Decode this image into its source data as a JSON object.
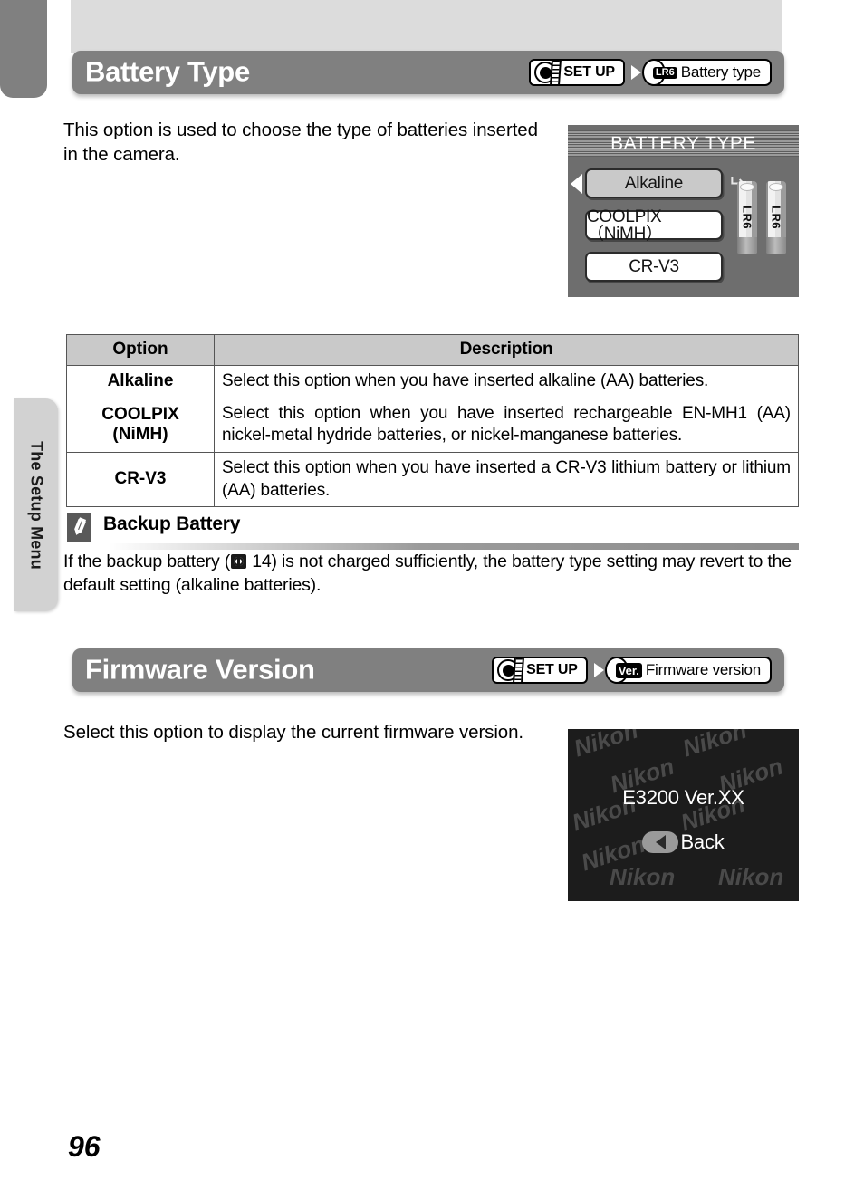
{
  "sidebar": {
    "chapter_label": "The Setup Menu"
  },
  "page": {
    "number": "96"
  },
  "sections": [
    {
      "title": "Battery Type",
      "breadcrumb": {
        "mode_label": "SET UP",
        "mode_icon": "mode-dial-icon",
        "item_badge": "LR6",
        "item_label": "Battery type"
      },
      "body": "This option is used to choose the type of batteries inserted in the camera."
    },
    {
      "title": "Firmware Version",
      "breadcrumb": {
        "mode_label": "SET UP",
        "mode_icon": "mode-dial-icon",
        "item_badge": "Ver.",
        "item_label": "Firmware version"
      },
      "body": "Select this option to display the current firmware version."
    }
  ],
  "battery_lcd": {
    "title": "BATTERY TYPE",
    "options": [
      {
        "label": "Alkaline",
        "selected": true
      },
      {
        "label": "COOLPIX（NiMH）",
        "selected": false
      },
      {
        "label": "CR-V3",
        "selected": false
      }
    ],
    "enter_icon": "enter-return-icon",
    "cursor_icon": "left-cursor-icon",
    "battery_label": "LR6"
  },
  "firmware_lcd": {
    "version_text": "E3200 Ver.XX",
    "back_label": "Back",
    "back_icon": "left-arrow-icon",
    "watermark_text": "Nikon"
  },
  "table": {
    "headers": [
      "Option",
      "Description"
    ],
    "rows": [
      {
        "option": "Alkaline",
        "description": "Select this option when you have inserted alkaline (AA) batteries."
      },
      {
        "option": "COOLPIX\n(NiMH)",
        "description": "Select this option when you have inserted rechargeable EN-MH1 (AA) nickel-metal hydride batteries, or nickel-manganese batteries."
      },
      {
        "option": "CR-V3",
        "description": "Select this option when you have inserted a CR-V3 lithium battery or lithium (AA) batteries."
      }
    ]
  },
  "note": {
    "icon": "pencil-note-icon",
    "title": "Backup Battery",
    "text_before": "If the backup battery (",
    "ref_icon": "book-reference-icon",
    "ref_page": "14",
    "text_after": ") is not charged sufficiently, the battery type setting may revert to the default setting (alkaline batteries)."
  },
  "colors": {
    "header_bar": "#808080",
    "top_band": "#dcdcdc",
    "side_tab": "#d2d2d2",
    "lcd_bg": "#6e6e6e",
    "lcd_dark": "#1c1c1c",
    "table_header": "#c9c9c9"
  }
}
